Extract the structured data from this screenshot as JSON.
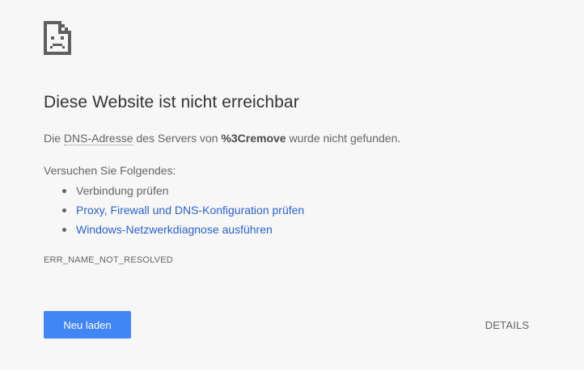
{
  "icon": {
    "name": "sad-document-icon"
  },
  "headline": "Diese Website ist nicht erreichbar",
  "summary": {
    "prefix": "Die ",
    "dns_term": "DNS-Adresse",
    "middle": " des Servers von ",
    "host": "%3Cremove",
    "suffix": " wurde nicht gefunden."
  },
  "suggestions": {
    "heading": "Versuchen Sie Folgendes:",
    "items": [
      {
        "label": "Verbindung prüfen",
        "is_link": false
      },
      {
        "label": "Proxy, Firewall und DNS-Konfiguration prüfen",
        "is_link": true
      },
      {
        "label": "Windows-Netzwerkdiagnose ausführen",
        "is_link": true
      }
    ]
  },
  "error_code": "ERR_NAME_NOT_RESOLVED",
  "buttons": {
    "reload_label": "Neu laden",
    "details_label": "DETAILS"
  },
  "colors": {
    "background": "#f7f7f7",
    "link": "#2a62c9",
    "primary_button": "#4285f4",
    "headline_text": "#333333",
    "body_text": "#646464"
  }
}
